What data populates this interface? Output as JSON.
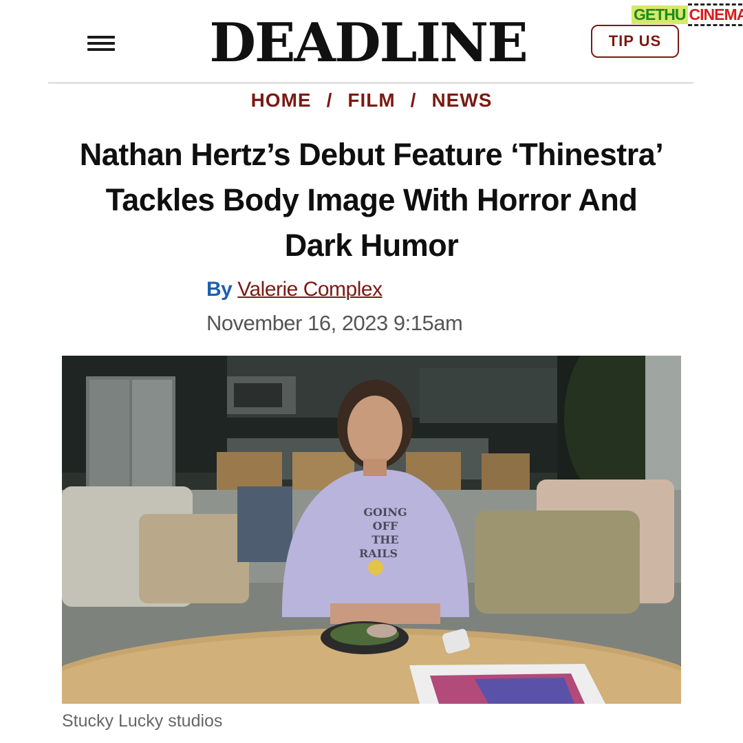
{
  "header": {
    "logo": "DEADLINE",
    "tip_label": "TIP US",
    "watermark_part1": "GETHU",
    "watermark_part2": "CINEMA"
  },
  "breadcrumb": [
    "HOME",
    "FILM",
    "NEWS"
  ],
  "article": {
    "headline": "Nathan Hertz’s Debut Feature ‘Thinestra’ Tackles Body Image With Horror And Dark Humor",
    "by_label": "By",
    "author": "Valerie Complex",
    "date": "November 16, 2023 9:15am",
    "photo_caption": "Stucky Lucky studios",
    "sweatshirt_text": [
      "GOING",
      "OFF",
      "THE",
      "RAILS"
    ]
  },
  "icons": {
    "menu": "hamburger-menu-icon"
  },
  "colors": {
    "brand_red": "#7a1a12",
    "byline_blue": "#1d5fb0",
    "sweater": "#b9b4dc"
  }
}
